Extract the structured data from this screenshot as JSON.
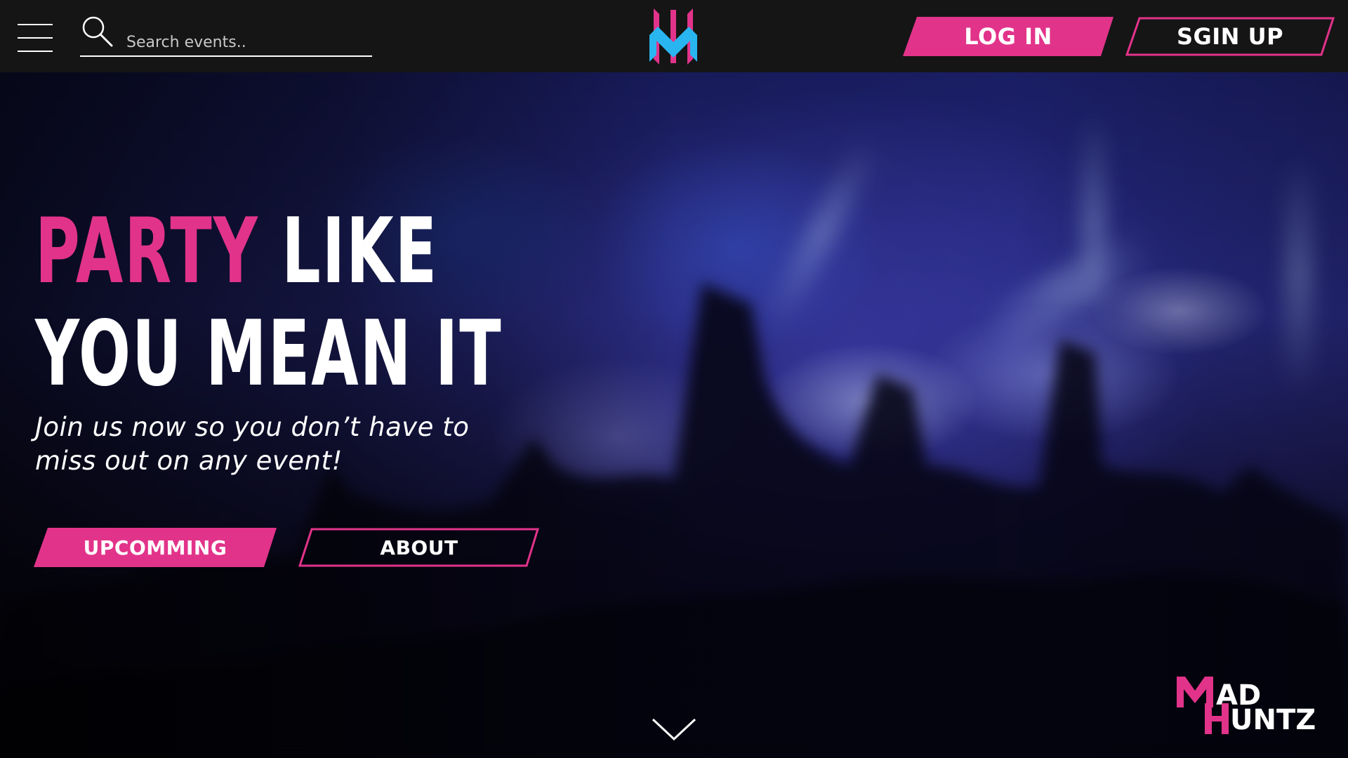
{
  "header": {
    "search": {
      "placeholder": "Search events..",
      "value": ""
    },
    "login_label": "LOG IN",
    "signup_label": "SGIN UP"
  },
  "hero": {
    "headline_accent": "PARTY",
    "headline_rest_line1": " LIKE",
    "headline_line2": "YOU MEAN IT",
    "subtitle_line1": "Join us now so you don’t have to",
    "subtitle_line2": "miss out on any event!",
    "upcoming_label": "UPCOMMING",
    "about_label": "ABOUT"
  },
  "brand": {
    "logo_text": [
      "MAD",
      "HUNTZ"
    ]
  },
  "colors": {
    "accent_pink": "#e2338a",
    "logo_blue": "#29b6f0",
    "topbar_bg": "#151515"
  },
  "icons": [
    "hamburger-menu-icon",
    "search-icon",
    "logo-mark",
    "chevron-down-icon",
    "brand-logo"
  ]
}
